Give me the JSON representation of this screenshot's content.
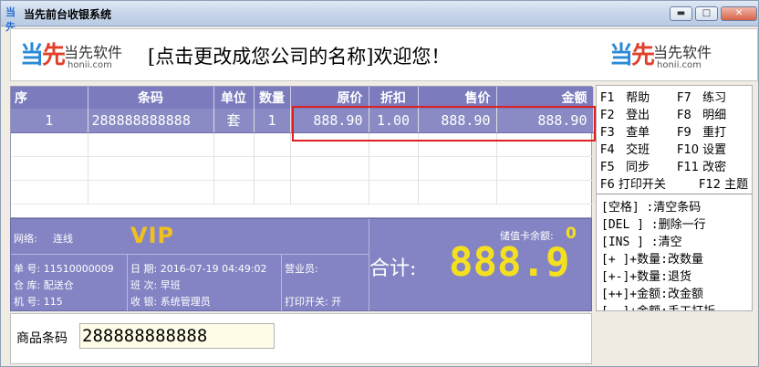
{
  "window": {
    "icon_text": "当先",
    "title": "当先前台收银系统",
    "min_btn": "▬",
    "max_btn": "□",
    "close_btn": "✕"
  },
  "banner": {
    "logo_big": "当",
    "logo_big_red": "先",
    "logo_small": "当先软件",
    "logo_url": "honii.com",
    "welcome": "[点击更改成您公司的名称]欢迎您！"
  },
  "table": {
    "headers": [
      "序",
      "条码",
      "单位",
      "数量",
      "原价",
      "折扣",
      "售价",
      "金额"
    ],
    "rows": [
      {
        "no": "1",
        "barcode": "288888888888",
        "unit": "套",
        "qty": "1",
        "orig_price": "888.90",
        "discount": "1.00",
        "price": "888.90",
        "amount": "888.90"
      }
    ]
  },
  "shortcuts": {
    "fkeys": [
      {
        "key": "F1",
        "label": "帮助"
      },
      {
        "key": "F7",
        "label": "练习"
      },
      {
        "key": "F2",
        "label": "登出"
      },
      {
        "key": "F8",
        "label": "明细"
      },
      {
        "key": "F3",
        "label": "查单"
      },
      {
        "key": "F9",
        "label": "重打"
      },
      {
        "key": "F4",
        "label": "交班"
      },
      {
        "key": "F10",
        "label": "设置"
      },
      {
        "key": "F5",
        "label": "同步"
      },
      {
        "key": "F11",
        "label": "改密"
      },
      {
        "key": "F6",
        "label": "打印开关"
      },
      {
        "key": "F12",
        "label": "主题"
      }
    ],
    "hotkeys": [
      "[空格]    :清空条码",
      "[DEL ]    :删除一行",
      "[INS ]    :清空",
      "[+ ]+数量:改数量",
      "[+-]+数量:退货",
      "[++]+金额:改金额",
      "[--]+金额:手工打折"
    ]
  },
  "info": {
    "network_label": "网络:",
    "network_value": "连线",
    "vip": "VIP",
    "balance_label": "储值卡余额:",
    "balance_value": "0",
    "order_no": "单  号: 11510000009",
    "warehouse": "仓  库: 配送仓",
    "machine": "机  号: 115",
    "date": "日  期: 2016-07-19 04:49:02",
    "shift": "班  次: 早班",
    "cashier": "收  银: 系统管理员",
    "salesperson": "营业员:",
    "print_switch": "打印开关: 开",
    "total_label": "合计:",
    "total_value": "888.9"
  },
  "input": {
    "label": "商品条码",
    "value": "288888888888"
  }
}
